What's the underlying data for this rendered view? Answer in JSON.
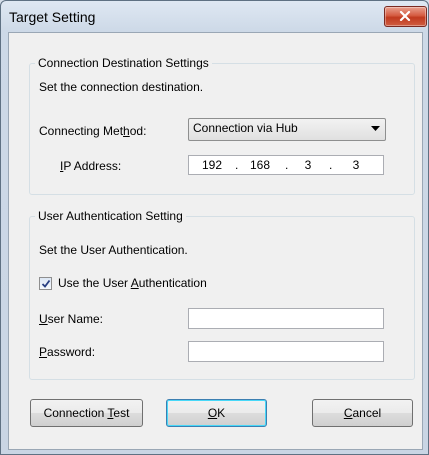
{
  "window": {
    "title": "Target Setting"
  },
  "connection_group": {
    "legend": "Connection Destination Settings",
    "instruction": "Set the connection destination.",
    "method_label_pre": "Connecting Met",
    "method_label_ul": "h",
    "method_label_post": "od:",
    "method_value": "Connection via Hub",
    "ip_label_ul": "I",
    "ip_label_post": "P Address:",
    "ip_octets": [
      "192",
      "168",
      "3",
      "3"
    ]
  },
  "auth_group": {
    "legend": "User Authentication Setting",
    "instruction": "Set the User Authentication.",
    "checkbox_label_pre": "Use the User ",
    "checkbox_label_ul": "A",
    "checkbox_label_post": "uthentication",
    "checkbox_checked": true,
    "username_label_ul": "U",
    "username_label_post": "ser Name:",
    "username_value": "",
    "password_label_ul": "P",
    "password_label_post": "assword:",
    "password_value": ""
  },
  "buttons": {
    "test_pre": "Connection ",
    "test_ul": "T",
    "test_post": "est",
    "ok_ul": "O",
    "ok_post": "K",
    "cancel_ul": "C",
    "cancel_post": "ancel"
  },
  "icons": [
    "close-icon",
    "dropdown-arrow-icon",
    "checkmark-icon"
  ],
  "colors": {
    "close_button": "#c94a2f",
    "default_button_border": "#3c7fb1"
  }
}
